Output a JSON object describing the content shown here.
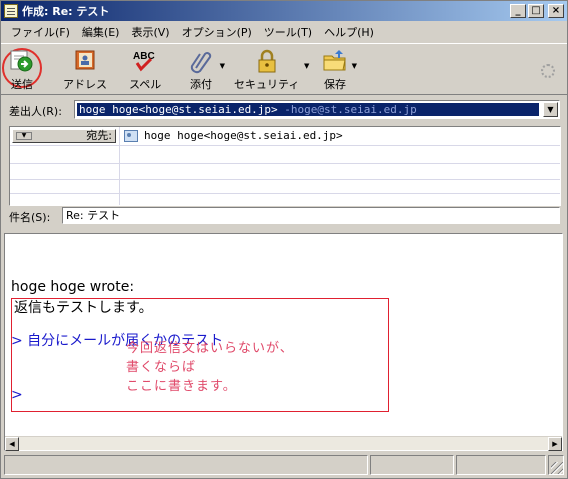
{
  "window": {
    "title": "作成: Re: テスト"
  },
  "menubar": [
    "ファイル(F)",
    "編集(E)",
    "表示(V)",
    "オプション(P)",
    "ツール(T)",
    "ヘルプ(H)"
  ],
  "toolbar": {
    "send": "送信",
    "address": "アドレス",
    "spell": "スペル",
    "spell_icon_text": "ABC",
    "attach": "添付",
    "security": "セキュリティ",
    "save": "保存"
  },
  "from": {
    "label": "差出人(R):",
    "value": "hoge hoge<hoge@st.seiai.ed.jp>",
    "account": " -hoge@st.seiai.ed.jp"
  },
  "recipients": {
    "type_label": "宛先:",
    "entries": [
      "hoge hoge<hoge@st.seiai.ed.jp>"
    ]
  },
  "subject": {
    "label": "件名(S):",
    "value": "Re: テスト"
  },
  "body": {
    "wrote_line": "hoge hoge wrote:",
    "quote_line": "> 自分にメールが届くかのテスト",
    "quote_empty": ">",
    "reply_line": "返信もテストします。",
    "annotation": "今回返信文はいらないが、\n書くならば\nここに書きます。"
  },
  "colors": {
    "titlebar_start": "#0a246a",
    "quote": "#1a1acc",
    "highlight_box": "#e02030",
    "annotation": "#e04a6a"
  },
  "icons": [
    "send-icon",
    "address-book-icon",
    "spell-check-icon",
    "paperclip-icon",
    "lock-icon",
    "save-folder-icon",
    "throbber-icon"
  ]
}
